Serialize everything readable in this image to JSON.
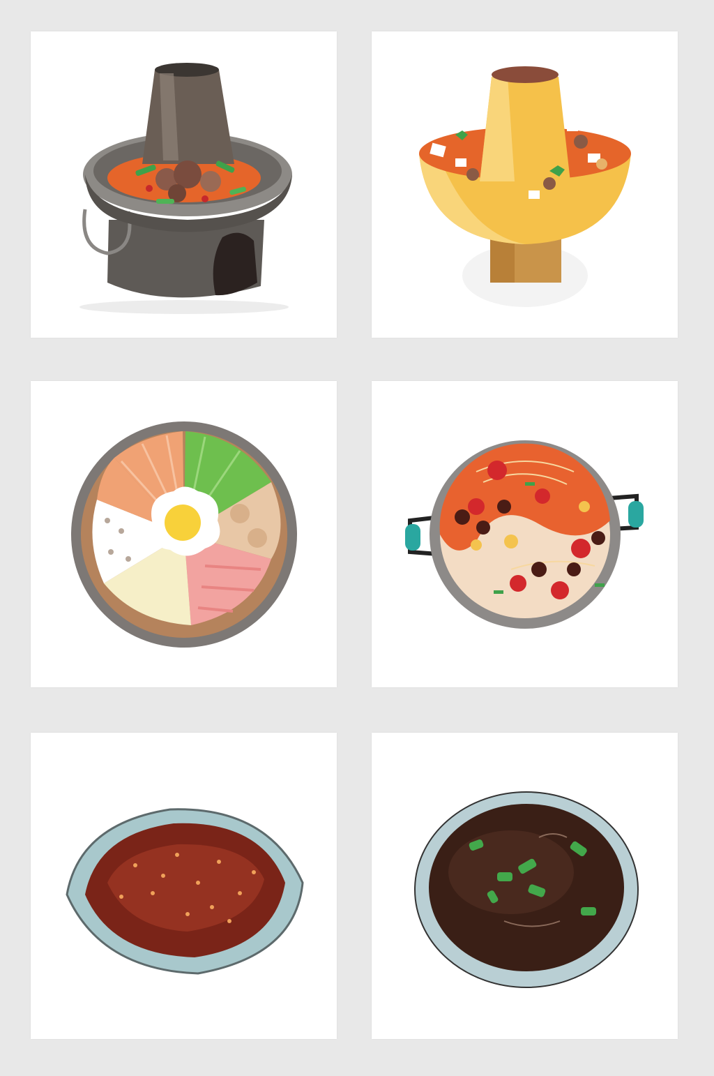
{
  "gallery": {
    "items": [
      {
        "icon": "copper-hotpot-icon"
      },
      {
        "icon": "cartoon-hotpot-icon"
      },
      {
        "icon": "bibimbap-bowl-icon"
      },
      {
        "icon": "yuanyang-hotpot-icon"
      },
      {
        "icon": "chili-sauce-dish-icon"
      },
      {
        "icon": "soy-sauce-dish-icon"
      }
    ]
  },
  "colors": {
    "background": "#e8e8e8",
    "card": "#ffffff",
    "broth_orange": "#e5652a",
    "metal_grey": "#6e6b68",
    "brass_yellow": "#f5c14a"
  }
}
